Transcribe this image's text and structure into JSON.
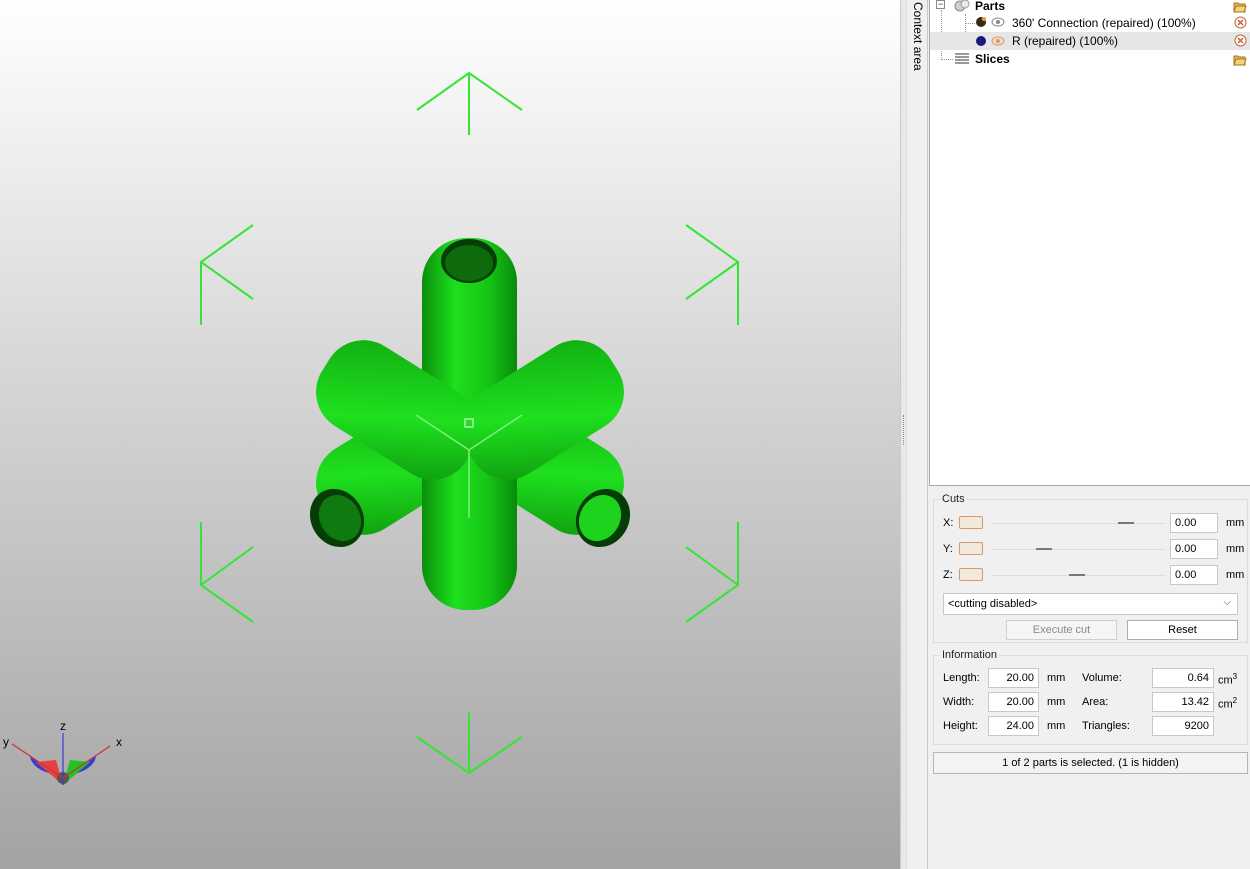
{
  "context_strip": {
    "label": "Context area"
  },
  "tree": {
    "parts": {
      "label": "Parts"
    },
    "items": [
      {
        "label": "360' Connection (repaired) (100%)",
        "color": "#3a2a10"
      },
      {
        "label": "R (repaired) (100%)",
        "color": "#1a1a7a"
      }
    ],
    "slices": {
      "label": "Slices"
    }
  },
  "cuts": {
    "title": "Cuts",
    "axes": [
      {
        "label": "X:",
        "value": "0.00",
        "unit": "mm"
      },
      {
        "label": "Y:",
        "value": "0.00",
        "unit": "mm"
      },
      {
        "label": "Z:",
        "value": "0.00",
        "unit": "mm"
      }
    ],
    "mode": "<cutting disabled>",
    "execute_label": "Execute cut",
    "reset_label": "Reset"
  },
  "information": {
    "title": "Information",
    "length": {
      "label": "Length:",
      "value": "20.00",
      "unit": "mm"
    },
    "width": {
      "label": "Width:",
      "value": "20.00",
      "unit": "mm"
    },
    "height": {
      "label": "Height:",
      "value": "24.00",
      "unit": "mm"
    },
    "volume": {
      "label": "Volume:",
      "value": "0.64",
      "unit": "cm",
      "unit_sup": "3"
    },
    "area": {
      "label": "Area:",
      "value": "13.42",
      "unit": "cm",
      "unit_sup": "2"
    },
    "triangles": {
      "label": "Triangles:",
      "value": "9200"
    }
  },
  "status": {
    "text": "1 of 2 parts is selected. (1 is hidden)"
  },
  "axis_gizmo": {
    "x": "x",
    "y": "y",
    "z": "z"
  },
  "colors": {
    "model": "#1ed31e",
    "bbox": "#33e633",
    "accent": "#d39a6a"
  }
}
